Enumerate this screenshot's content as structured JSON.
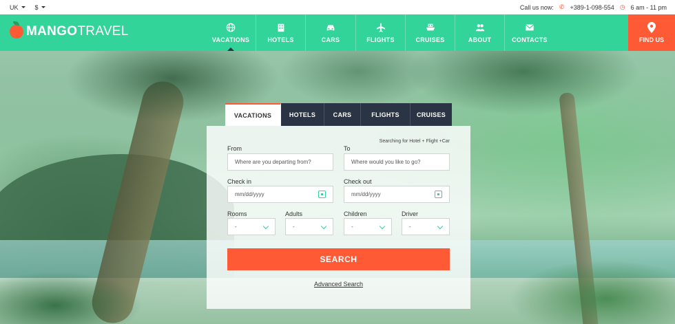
{
  "topbar": {
    "locale": "UK",
    "currency": "$",
    "call_label": "Call us now:",
    "phone": "+389-1-098-554",
    "hours": "6 am - 11 pm"
  },
  "brand": {
    "name_bold": "MANGO",
    "name_rest": "TRAVEL"
  },
  "nav": {
    "items": [
      {
        "label": "VACATIONS",
        "icon": "globe-icon"
      },
      {
        "label": "HOTELS",
        "icon": "building-icon"
      },
      {
        "label": "CARS",
        "icon": "car-icon"
      },
      {
        "label": "FLIGHTS",
        "icon": "airplane-icon"
      },
      {
        "label": "CRUISES",
        "icon": "ship-icon"
      },
      {
        "label": "ABOUT",
        "icon": "people-icon"
      },
      {
        "label": "CONTACTS",
        "icon": "envelope-icon"
      }
    ],
    "find_us": "FIND US"
  },
  "search": {
    "tabs": [
      "VACATIONS",
      "HOTELS",
      "CARS",
      "FLIGHTS",
      "CRUISES"
    ],
    "note": "Searching for Hotel + Flight +Car",
    "from_label": "From",
    "from_placeholder": "Where are you departing from?",
    "to_label": "To",
    "to_placeholder": "Where would you like to go?",
    "checkin_label": "Check in",
    "checkin_placeholder": "mm/dd/yyyy",
    "checkout_label": "Check out",
    "checkout_placeholder": "mm/dd/yyyy",
    "rooms_label": "Rooms",
    "rooms_value": "-",
    "adults_label": "Adults",
    "adults_value": "-",
    "children_label": "Children",
    "children_value": "-",
    "driver_label": "Driver",
    "driver_value": "-",
    "search_button": "SEARCH",
    "advanced_link": "Advanced Search"
  },
  "colors": {
    "accent": "#33d49a",
    "cta": "#ff5a36",
    "dark": "#2b3444"
  }
}
